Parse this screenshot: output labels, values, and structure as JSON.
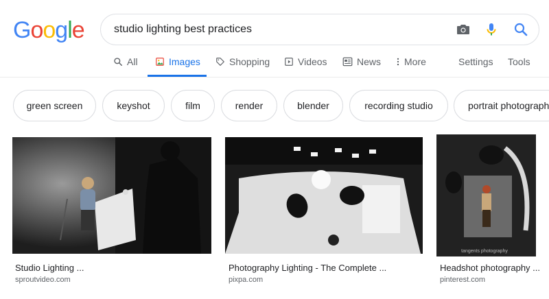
{
  "logo": {
    "letters": [
      "G",
      "o",
      "o",
      "g",
      "l",
      "e"
    ],
    "colors": [
      "#4285f4",
      "#ea4335",
      "#fbbc05",
      "#4285f4",
      "#34a853",
      "#ea4335"
    ]
  },
  "search": {
    "query": "studio lighting best practices"
  },
  "tabs": {
    "all": "All",
    "images": "Images",
    "shopping": "Shopping",
    "videos": "Videos",
    "news": "News",
    "more": "More",
    "settings": "Settings",
    "tools": "Tools"
  },
  "chips": [
    "green screen",
    "keyshot",
    "film",
    "render",
    "blender",
    "recording studio",
    "portrait photograph"
  ],
  "results": [
    {
      "title": "Studio Lighting ...",
      "source": "sproutvideo.com"
    },
    {
      "title": "Photography Lighting - The Complete ...",
      "source": "pixpa.com"
    },
    {
      "title": "Headshot photography ...",
      "source": "pinterest.com",
      "watermark": "tangents photography"
    }
  ],
  "colors": {
    "accent": "#1a73e8",
    "muted": "#5f6368"
  }
}
